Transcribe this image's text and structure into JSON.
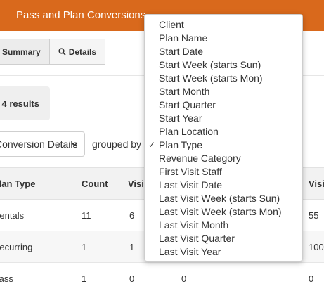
{
  "header": {
    "title": "Pass and Plan Conversions"
  },
  "tabs": [
    {
      "label": "Summary"
    },
    {
      "label": "Details",
      "icon": "search-icon"
    }
  ],
  "results": {
    "label": "4 results"
  },
  "view_select": {
    "value": "Conversion Details"
  },
  "grouped_by": {
    "label": "grouped by"
  },
  "table": {
    "columns": [
      "Plan Type",
      "Count",
      "Visi",
      "Visi"
    ],
    "rows": [
      {
        "type": "Rentals",
        "count": "11",
        "c3": "6",
        "c4": "",
        "c5": "55"
      },
      {
        "type": "Recurring",
        "count": "1",
        "c3": "1",
        "c4": "",
        "c5": "100"
      },
      {
        "type": "Pass",
        "count": "1",
        "c3": "0",
        "c4": "0",
        "c5": "0"
      }
    ]
  },
  "groupby_menu": {
    "selected": "Plan Type",
    "items": [
      "Client",
      "Plan Name",
      "Start Date",
      "Start Week (starts Sun)",
      "Start Week (starts Mon)",
      "Start Month",
      "Start Quarter",
      "Start Year",
      "Plan Location",
      "Plan Type",
      "Revenue Category",
      "First Visit Staff",
      "Last Visit Date",
      "Last Visit Week (starts Sun)",
      "Last Visit Week (starts Mon)",
      "Last Visit Month",
      "Last Visit Quarter",
      "Last Visit Year"
    ]
  },
  "colors": {
    "header_bg": "#d9691c"
  }
}
